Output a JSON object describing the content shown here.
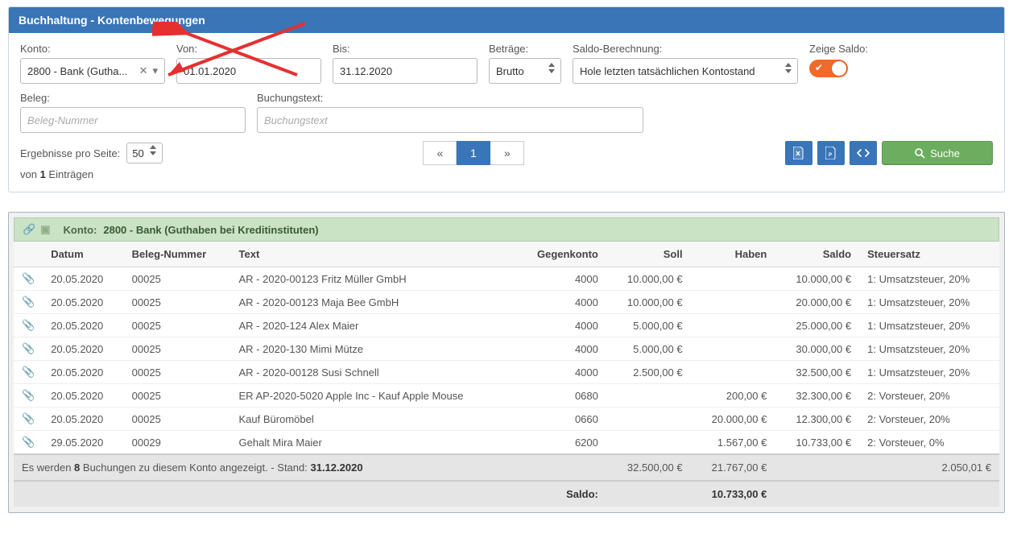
{
  "header": {
    "title": "Buchhaltung - Kontenbewegungen"
  },
  "filters": {
    "konto_label": "Konto:",
    "konto_value": "2800 - Bank (Gutha...",
    "von_label": "Von:",
    "von_value": "01.01.2020",
    "bis_label": "Bis:",
    "bis_value": "31.12.2020",
    "betraege_label": "Beträge:",
    "betraege_value": "Brutto",
    "saldo_calc_label": "Saldo-Berechnung:",
    "saldo_calc_value": "Hole letzten tatsächlichen Kontostand",
    "zeige_saldo_label": "Zeige Saldo:",
    "beleg_label": "Beleg:",
    "beleg_placeholder": "Beleg-Nummer",
    "buchungstext_label": "Buchungstext:",
    "buchungstext_placeholder": "Buchungstext"
  },
  "listctrl": {
    "results_label": "Ergebnisse pro Seite:",
    "results_value": "50",
    "entries_prefix": "von ",
    "entries_count": "1",
    "entries_suffix": " Einträgen",
    "page_prev": "«",
    "page_num": "1",
    "page_next": "»",
    "search_label": "Suche"
  },
  "table": {
    "konto_header_label": "Konto:",
    "konto_header_value": "2800 - Bank (Guthaben bei Kreditinstituten)",
    "cols": {
      "datum": "Datum",
      "beleg": "Beleg-Nummer",
      "text": "Text",
      "gegenkonto": "Gegenkonto",
      "soll": "Soll",
      "haben": "Haben",
      "saldo": "Saldo",
      "steuersatz": "Steuersatz"
    },
    "rows": [
      {
        "datum": "20.05.2020",
        "beleg": "00025",
        "text": "AR - 2020-00123 Fritz Müller GmbH",
        "gegenkonto": "4000",
        "soll": "10.000,00 €",
        "haben": "",
        "saldo": "10.000,00 €",
        "steuer": "1: Umsatzsteuer, 20%"
      },
      {
        "datum": "20.05.2020",
        "beleg": "00025",
        "text": "AR - 2020-00123 Maja Bee GmbH",
        "gegenkonto": "4000",
        "soll": "10.000,00 €",
        "haben": "",
        "saldo": "20.000,00 €",
        "steuer": "1: Umsatzsteuer, 20%"
      },
      {
        "datum": "20.05.2020",
        "beleg": "00025",
        "text": "AR - 2020-124 Alex Maier",
        "gegenkonto": "4000",
        "soll": "5.000,00 €",
        "haben": "",
        "saldo": "25.000,00 €",
        "steuer": "1: Umsatzsteuer, 20%"
      },
      {
        "datum": "20.05.2020",
        "beleg": "00025",
        "text": "AR - 2020-130 Mimi Mütze",
        "gegenkonto": "4000",
        "soll": "5.000,00 €",
        "haben": "",
        "saldo": "30.000,00 €",
        "steuer": "1: Umsatzsteuer, 20%"
      },
      {
        "datum": "20.05.2020",
        "beleg": "00025",
        "text": "AR - 2020-00128 Susi Schnell",
        "gegenkonto": "4000",
        "soll": "2.500,00 €",
        "haben": "",
        "saldo": "32.500,00 €",
        "steuer": "1: Umsatzsteuer, 20%"
      },
      {
        "datum": "20.05.2020",
        "beleg": "00025",
        "text": "ER AP-2020-5020 Apple Inc - Kauf Apple Mouse",
        "gegenkonto": "0680",
        "soll": "",
        "haben": "200,00 €",
        "saldo": "32.300,00 €",
        "steuer": "2: Vorsteuer, 20%"
      },
      {
        "datum": "20.05.2020",
        "beleg": "00025",
        "text": "Kauf Büromöbel",
        "gegenkonto": "0660",
        "soll": "",
        "haben": "20.000,00 €",
        "saldo": "12.300,00 €",
        "steuer": "2: Vorsteuer, 20%"
      },
      {
        "datum": "29.05.2020",
        "beleg": "00029",
        "text": "Gehalt Mira Maier",
        "gegenkonto": "6200",
        "soll": "",
        "haben": "1.567,00 €",
        "saldo": "10.733,00 €",
        "steuer": "2: Vorsteuer, 0%"
      }
    ],
    "footer": {
      "summary_pre": "Es werden ",
      "summary_count": "8",
      "summary_mid": " Buchungen zu diesem Konto angezeigt. - Stand: ",
      "summary_date": "31.12.2020",
      "sum_soll": "32.500,00 €",
      "sum_haben": "21.767,00 €",
      "sum_right": "2.050,01 €",
      "saldo_label": "Saldo:",
      "saldo_value": "10.733,00 €"
    }
  }
}
